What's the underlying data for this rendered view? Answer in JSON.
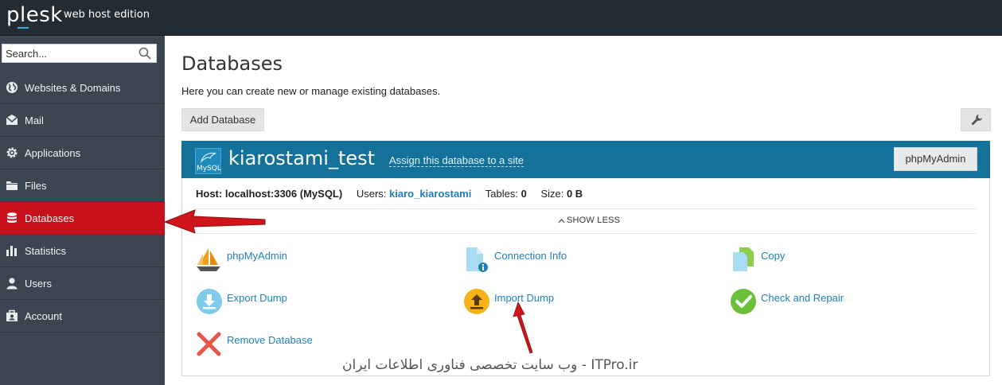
{
  "header": {
    "logo": "plesk",
    "edition": "web host edition"
  },
  "sidebar": {
    "search_placeholder": "Search...",
    "items": [
      {
        "label": "Websites & Domains",
        "icon": "globe-icon"
      },
      {
        "label": "Mail",
        "icon": "mail-icon"
      },
      {
        "label": "Applications",
        "icon": "gear-icon"
      },
      {
        "label": "Files",
        "icon": "folder-icon"
      },
      {
        "label": "Databases",
        "icon": "database-icon",
        "active": true
      },
      {
        "label": "Statistics",
        "icon": "bar-chart-icon"
      },
      {
        "label": "Users",
        "icon": "user-icon"
      },
      {
        "label": "Account",
        "icon": "account-icon"
      }
    ]
  },
  "main": {
    "title": "Databases",
    "description": "Here you can create new or manage existing databases.",
    "add_button": "Add Database",
    "database": {
      "name": "kiarostami_test",
      "logo_text": "MySQL",
      "assign_link": "Assign this database to a site",
      "phpmyadmin_button": "phpMyAdmin",
      "host_label": "Host: localhost:3306 (MySQL)",
      "users_label": "Users:",
      "users_value": "kiaro_kiarostami",
      "tables_label": "Tables:",
      "tables_value": "0",
      "size_label": "Size:",
      "size_value": "0 B",
      "show_less": "SHOW LESS",
      "tools": [
        {
          "label": "phpMyAdmin",
          "icon": "sailboat-icon"
        },
        {
          "label": "Connection Info",
          "icon": "file-info-icon"
        },
        {
          "label": "Copy",
          "icon": "copy-icon"
        },
        {
          "label": "Export Dump",
          "icon": "download-icon"
        },
        {
          "label": "Import Dump",
          "icon": "upload-icon"
        },
        {
          "label": "Check and Repair",
          "icon": "checkmark-icon"
        },
        {
          "label": "Remove Database",
          "icon": "remove-x-icon"
        }
      ]
    }
  },
  "watermark": "ITPro.ir - وب سایت تخصصی فناوری اطلاعات ایران",
  "colors": {
    "topbar": "#232b33",
    "sidebar": "#3c4650",
    "active": "#c7101b",
    "panel_head": "#14729a",
    "link": "#1f7fb8"
  }
}
